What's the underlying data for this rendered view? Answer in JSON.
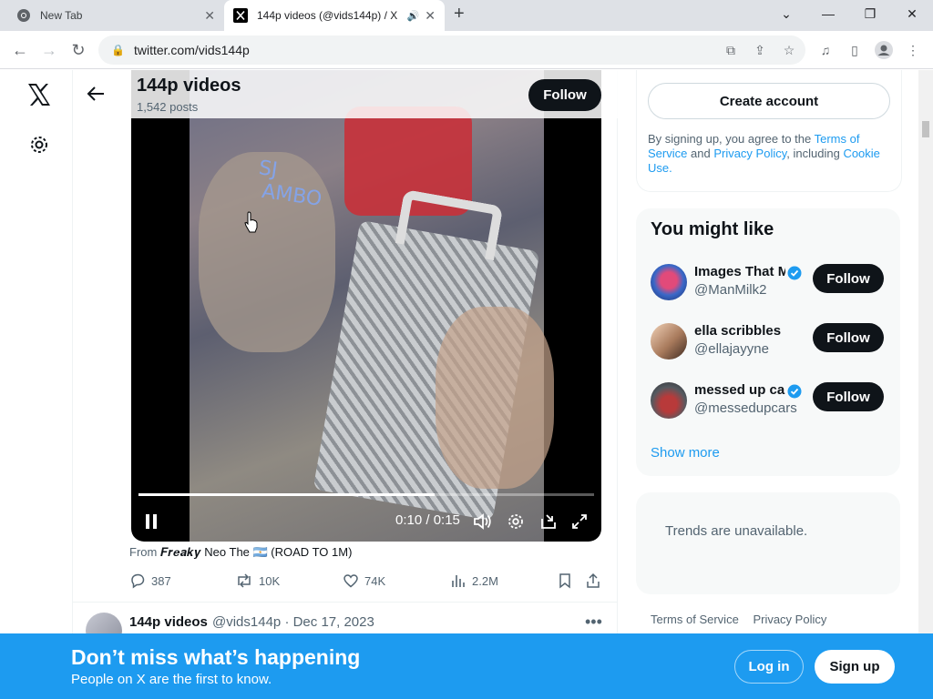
{
  "browser": {
    "tabs": [
      {
        "label": "New Tab"
      },
      {
        "label": "144p videos (@vids144p) / X"
      }
    ],
    "url": "twitter.com/vids144p"
  },
  "profile": {
    "name": "144p videos",
    "posts": "1,542 posts",
    "follow_label": "Follow"
  },
  "video": {
    "time": "0:10 / 0:15",
    "progress": 0.65
  },
  "post": {
    "from_prefix": "From",
    "from_source": "𝑭𝒓𝒆𝒂𝒌𝒚 Neo The 🇦🇷 (ROAD TO 1M)",
    "replies": "387",
    "reposts": "10K",
    "likes": "74K",
    "views": "2.2M"
  },
  "post2": {
    "name": "144p videos",
    "meta": "@vids144p · Dec 17, 2023"
  },
  "signup": {
    "create_account": "Create account",
    "terms_prefix": "By signing up, you agree to the",
    "terms_of_service": "Terms of Service",
    "and": "and",
    "privacy_policy": "Privacy Policy",
    "including": ", including",
    "cookie_use": "Cookie Use."
  },
  "you_might_like": {
    "title": "You might like",
    "users": [
      {
        "name": "Images That M",
        "handle": "@ManMilk2",
        "verified": true,
        "follow": "Follow"
      },
      {
        "name": "ella scribbles",
        "handle": "@ellajayyne",
        "verified": false,
        "follow": "Follow"
      },
      {
        "name": "messed up ca",
        "handle": "@messedupcars",
        "verified": true,
        "follow": "Follow"
      }
    ],
    "show_more": "Show more"
  },
  "trends": {
    "message": "Trends are unavailable."
  },
  "footer": {
    "links": [
      "Terms of Service",
      "Privacy Policy"
    ]
  },
  "banner": {
    "title": "Don’t miss what’s happening",
    "subtitle": "People on X are the first to know.",
    "login": "Log in",
    "signup": "Sign up"
  },
  "colors": {
    "accent": "#1d9bf0",
    "text": "#0f1419",
    "muted": "#536471"
  }
}
